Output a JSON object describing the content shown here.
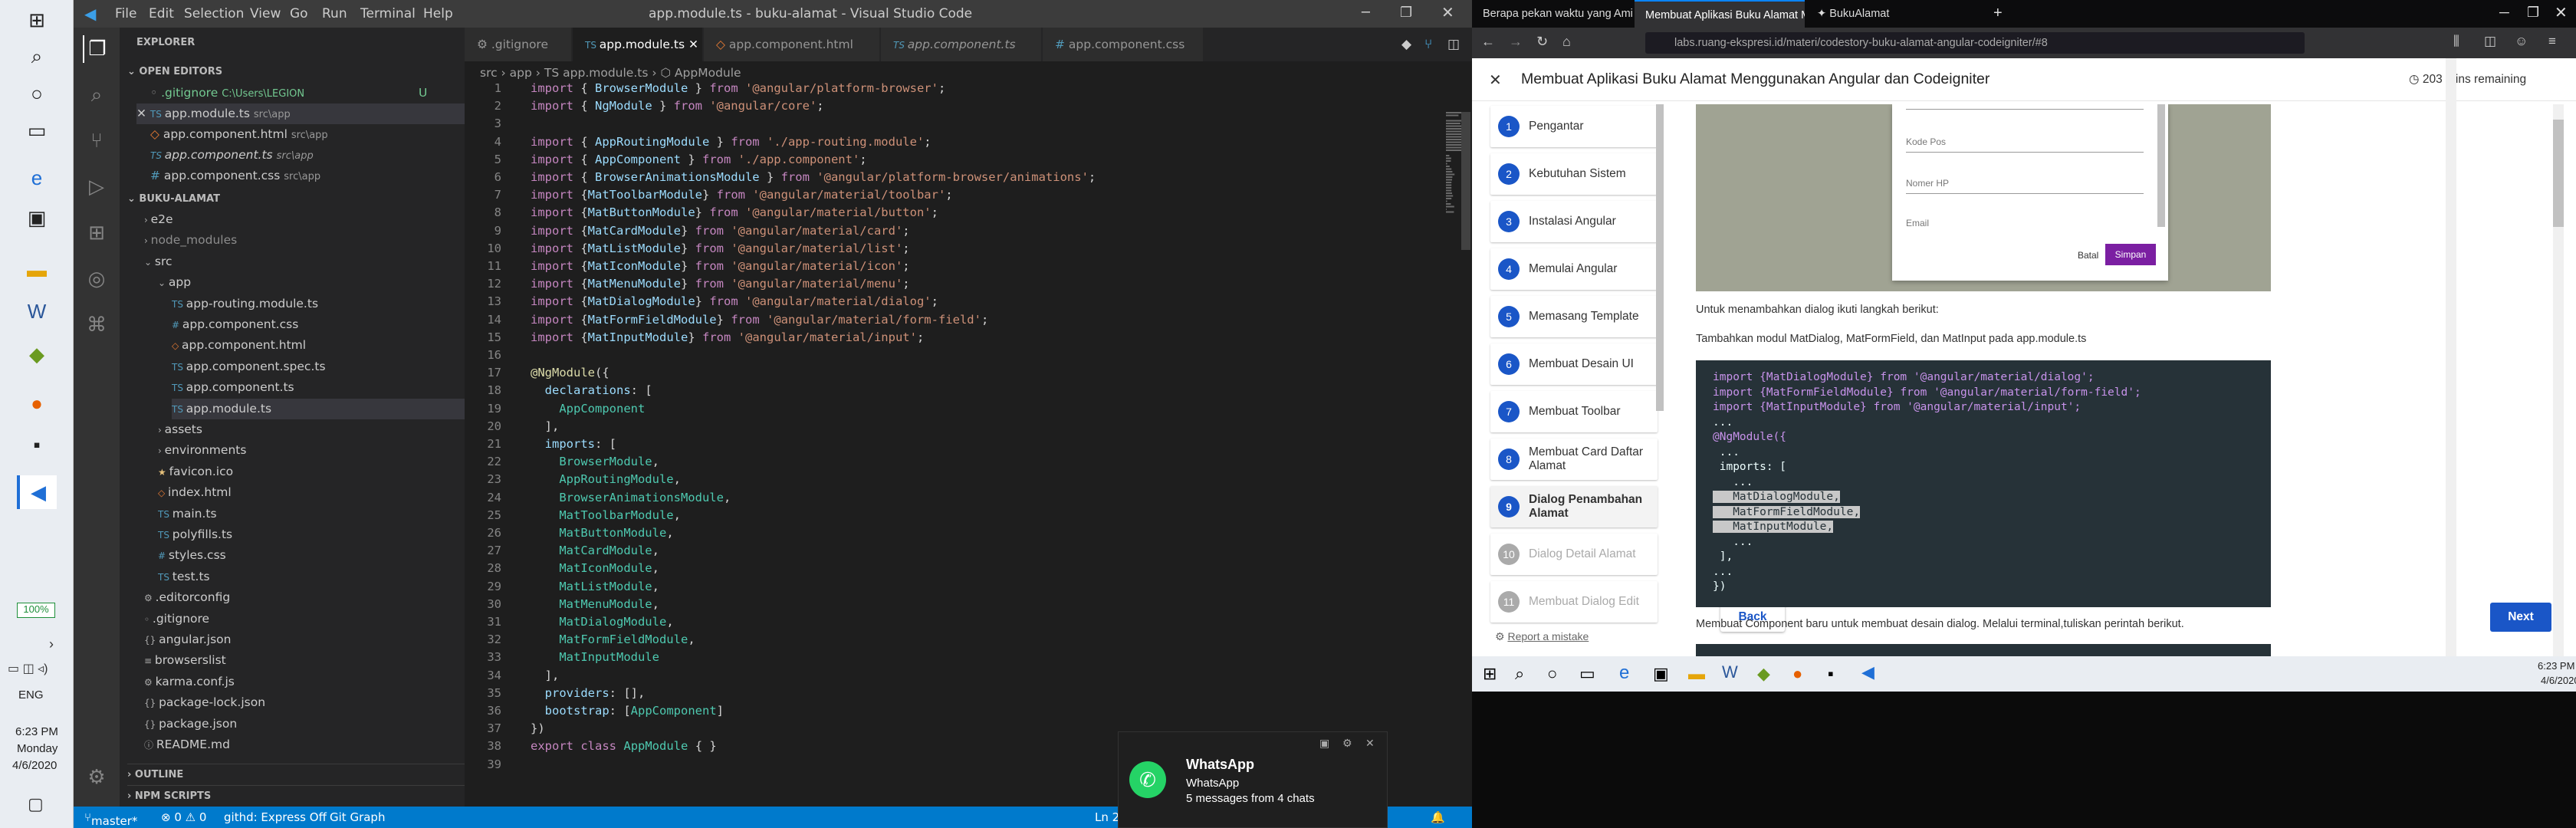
{
  "taskbar": {
    "zoom": "100%",
    "lang": "ENG",
    "time": "6:23 PM",
    "day": "Monday",
    "date": "4/6/2020"
  },
  "vscode": {
    "menu": [
      "File",
      "Edit",
      "Selection",
      "View",
      "Go",
      "Run",
      "Terminal",
      "Help"
    ],
    "title": "app.module.ts - buku-alamat - Visual Studio Code",
    "explorer": "EXPLORER",
    "open_editors_head": "OPEN EDITORS",
    "open_editors": [
      {
        "name": ".gitignore",
        "path": "C:\\Users\\LEGION",
        "badge": "U"
      },
      {
        "name": "app.module.ts",
        "path": "src\\app"
      },
      {
        "name": "app.component.html",
        "path": "src\\app"
      },
      {
        "name": "app.component.ts",
        "path": "src\\app"
      },
      {
        "name": "app.component.css",
        "path": "src\\app"
      }
    ],
    "project_head": "BUKU-ALAMAT",
    "tree": [
      "e2e",
      "node_modules",
      "src",
      "app",
      "app-routing.module.ts",
      "app.component.css",
      "app.component.html",
      "app.component.spec.ts",
      "app.component.ts",
      "app.module.ts",
      "assets",
      "environments",
      "favicon.ico",
      "index.html",
      "main.ts",
      "polyfills.ts",
      "styles.css",
      "test.ts",
      ".editorconfig",
      ".gitignore",
      "angular.json",
      "browserslist",
      "karma.conf.js",
      "package-lock.json",
      "package.json",
      "README.md"
    ],
    "outline": "OUTLINE",
    "npm": "NPM SCRIPTS",
    "tabs": [
      ".gitignore",
      "app.module.ts",
      "app.component.html",
      "app.component.ts",
      "app.component.css"
    ],
    "breadcrumb": "src › app › TS app.module.ts › ⬡ AppModule",
    "status": {
      "branch": "master*",
      "errors": "⊗ 0 ⚠ 0",
      "githd": "githd: Express Off",
      "graph": "Git Graph",
      "ln": "Ln 2"
    }
  },
  "whatsapp": {
    "title": "WhatsApp",
    "sub": "WhatsApp",
    "msg": "5 messages from 4 chats"
  },
  "browser": {
    "tabs": [
      "Berapa pekan waktu yang Ami",
      "Membuat Aplikasi Buku Alamat M",
      "BukuAlamat"
    ],
    "url": "labs.ruang-ekspresi.id/materi/codestory-buku-alamat-angular-codeigniter/#8",
    "page_title": "Membuat Aplikasi Buku Alamat Menggunakan Angular dan Codeigniter",
    "remaining": "203 mins remaining",
    "toc": [
      "Pengantar",
      "Kebutuhan Sistem",
      "Instalasi Angular",
      "Memulai Angular",
      "Memasang Template",
      "Membuat Desain UI",
      "Membuat Toolbar",
      "Membuat Card Daftar Alamat",
      "Dialog Penambahan Alamat",
      "Dialog Detail Alamat",
      "Membuat Dialog Edit"
    ],
    "report": "Report a mistake",
    "back": "Back",
    "next": "Next",
    "dialog_fields": [
      "Kode Pos",
      "Nomer HP",
      "Email"
    ],
    "batal": "Batal",
    "simpan": "Simpan",
    "p1": "Untuk menambahkan dialog ikuti langkah berikut:",
    "p2": "Tambahkan modul MatDialog, MatFormField, dan MatInput pada app.module.ts",
    "p3": "Membuat Component baru untuk membuat desain dialog. Melalui terminal,tuliskan perintah berikut.",
    "clock": "6:23 PM",
    "date": "4/6/2020"
  }
}
